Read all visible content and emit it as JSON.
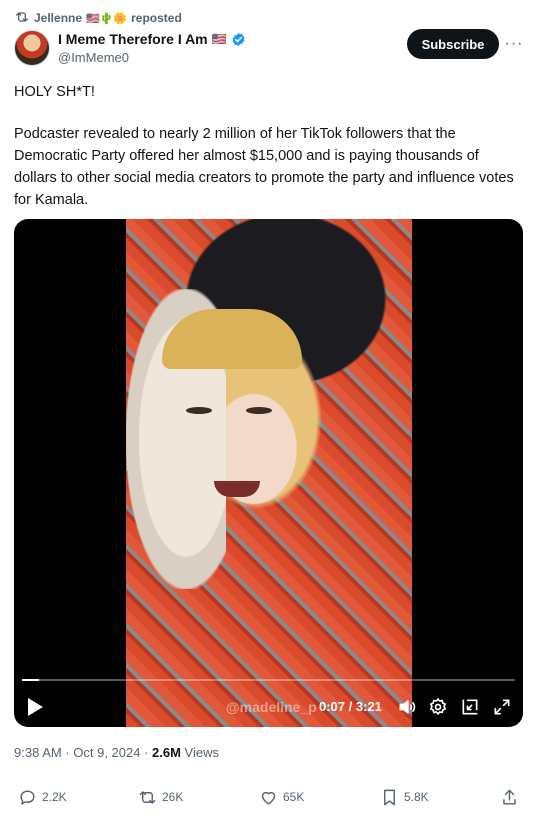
{
  "repost": {
    "name": "Jellenne",
    "badges": "🇺🇸🌵🌼",
    "label": "reposted"
  },
  "author": {
    "name": "I Meme Therefore I Am",
    "flag": "🇺🇸",
    "handle": "@ImMeme0",
    "verified": true,
    "subscribe_label": "Subscribe",
    "more_label": "···"
  },
  "post": {
    "line1": "HOLY SH*T!",
    "body": "Podcaster revealed to nearly 2 million of her TikTok followers that the Democratic Party offered her almost $15,000 and is paying thousands of dollars to other social media creators to promote the party and influence votes for Kamala."
  },
  "video": {
    "time_display": "0:07 / 3:21",
    "progress": 0.035,
    "watermark": "@madeline_p"
  },
  "meta": {
    "timestamp": "9:38 AM · Oct 9, 2024 · ",
    "views_count": "2.6M",
    "views_label": " Views"
  },
  "actions": {
    "replies": "2.2K",
    "reposts": "26K",
    "likes": "65K",
    "bookmarks": "5.8K"
  },
  "colors": {
    "text": "#0f1419",
    "secondary": "#536471",
    "verified": "#1d9bf0",
    "button": "#0f1419"
  }
}
